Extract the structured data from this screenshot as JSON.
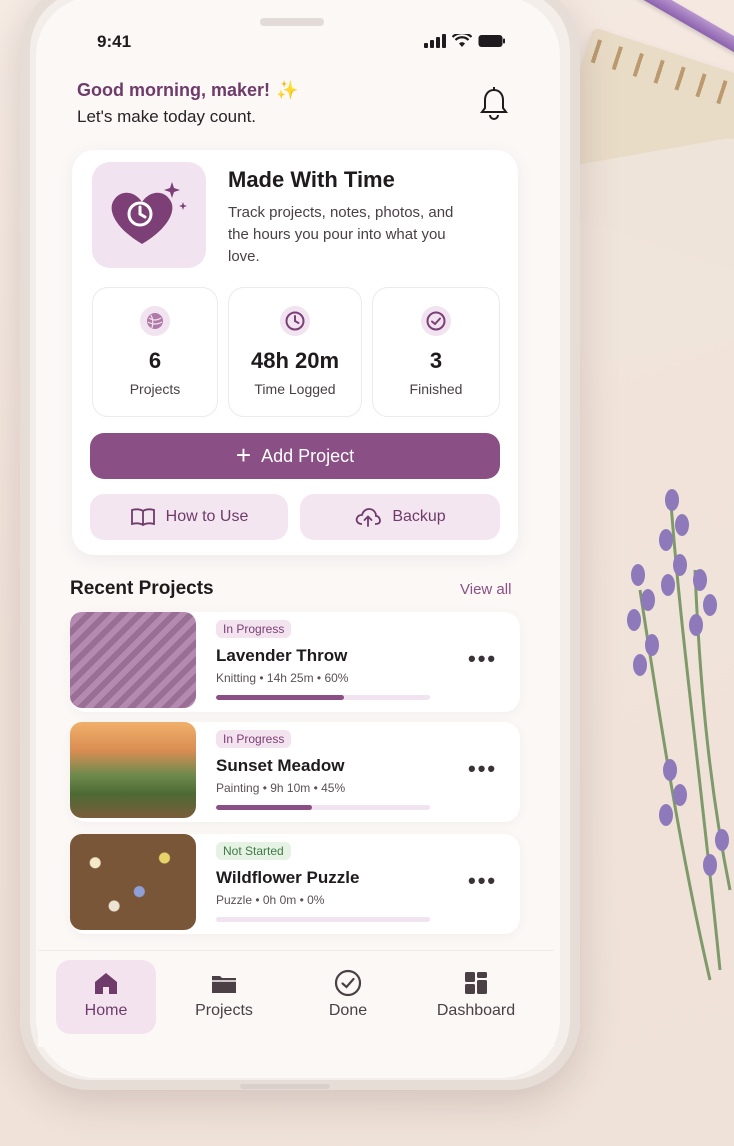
{
  "status_bar": {
    "time": "9:41"
  },
  "header": {
    "greeting": "Good morning, maker!",
    "subtitle": "Let's make today count."
  },
  "app": {
    "title": "Made With Time",
    "description": "Track projects, notes, photos, and the hours you pour into what you love."
  },
  "stats": [
    {
      "value": "6",
      "label": "Projects",
      "icon": "yarn-icon"
    },
    {
      "value": "48h 20m",
      "label": "Time Logged",
      "icon": "clock-icon"
    },
    {
      "value": "3",
      "label": "Finished",
      "icon": "check-circle-icon"
    }
  ],
  "actions": {
    "add_project": "Add Project",
    "how_to_use": "How to Use",
    "backup": "Backup"
  },
  "recent": {
    "title": "Recent Projects",
    "view_all": "View all",
    "projects": [
      {
        "status": "In Progress",
        "name": "Lavender Throw",
        "meta": "Knitting  •  14h 25m  •  60%",
        "progress": 0.6
      },
      {
        "status": "In Progress",
        "name": "Sunset Meadow",
        "meta": "Painting  •  9h 10m  •  45%",
        "progress": 0.45
      },
      {
        "status": "Not Started",
        "name": "Wildflower Puzzle",
        "meta": "Puzzle  •  0h 0m  •  0%",
        "progress": 0.0
      }
    ]
  },
  "tabs": [
    {
      "label": "Home",
      "icon": "home-icon",
      "active": true
    },
    {
      "label": "Projects",
      "icon": "folder-icon",
      "active": false
    },
    {
      "label": "Done",
      "icon": "check-circle-icon",
      "active": false
    },
    {
      "label": "Dashboard",
      "icon": "dashboard-grid-icon",
      "active": false
    }
  ],
  "colors": {
    "accent": "#8a4f84",
    "accent_light": "#f3e3ef",
    "greeting": "#6e3b6b",
    "not_started": "#e6f2e3"
  }
}
